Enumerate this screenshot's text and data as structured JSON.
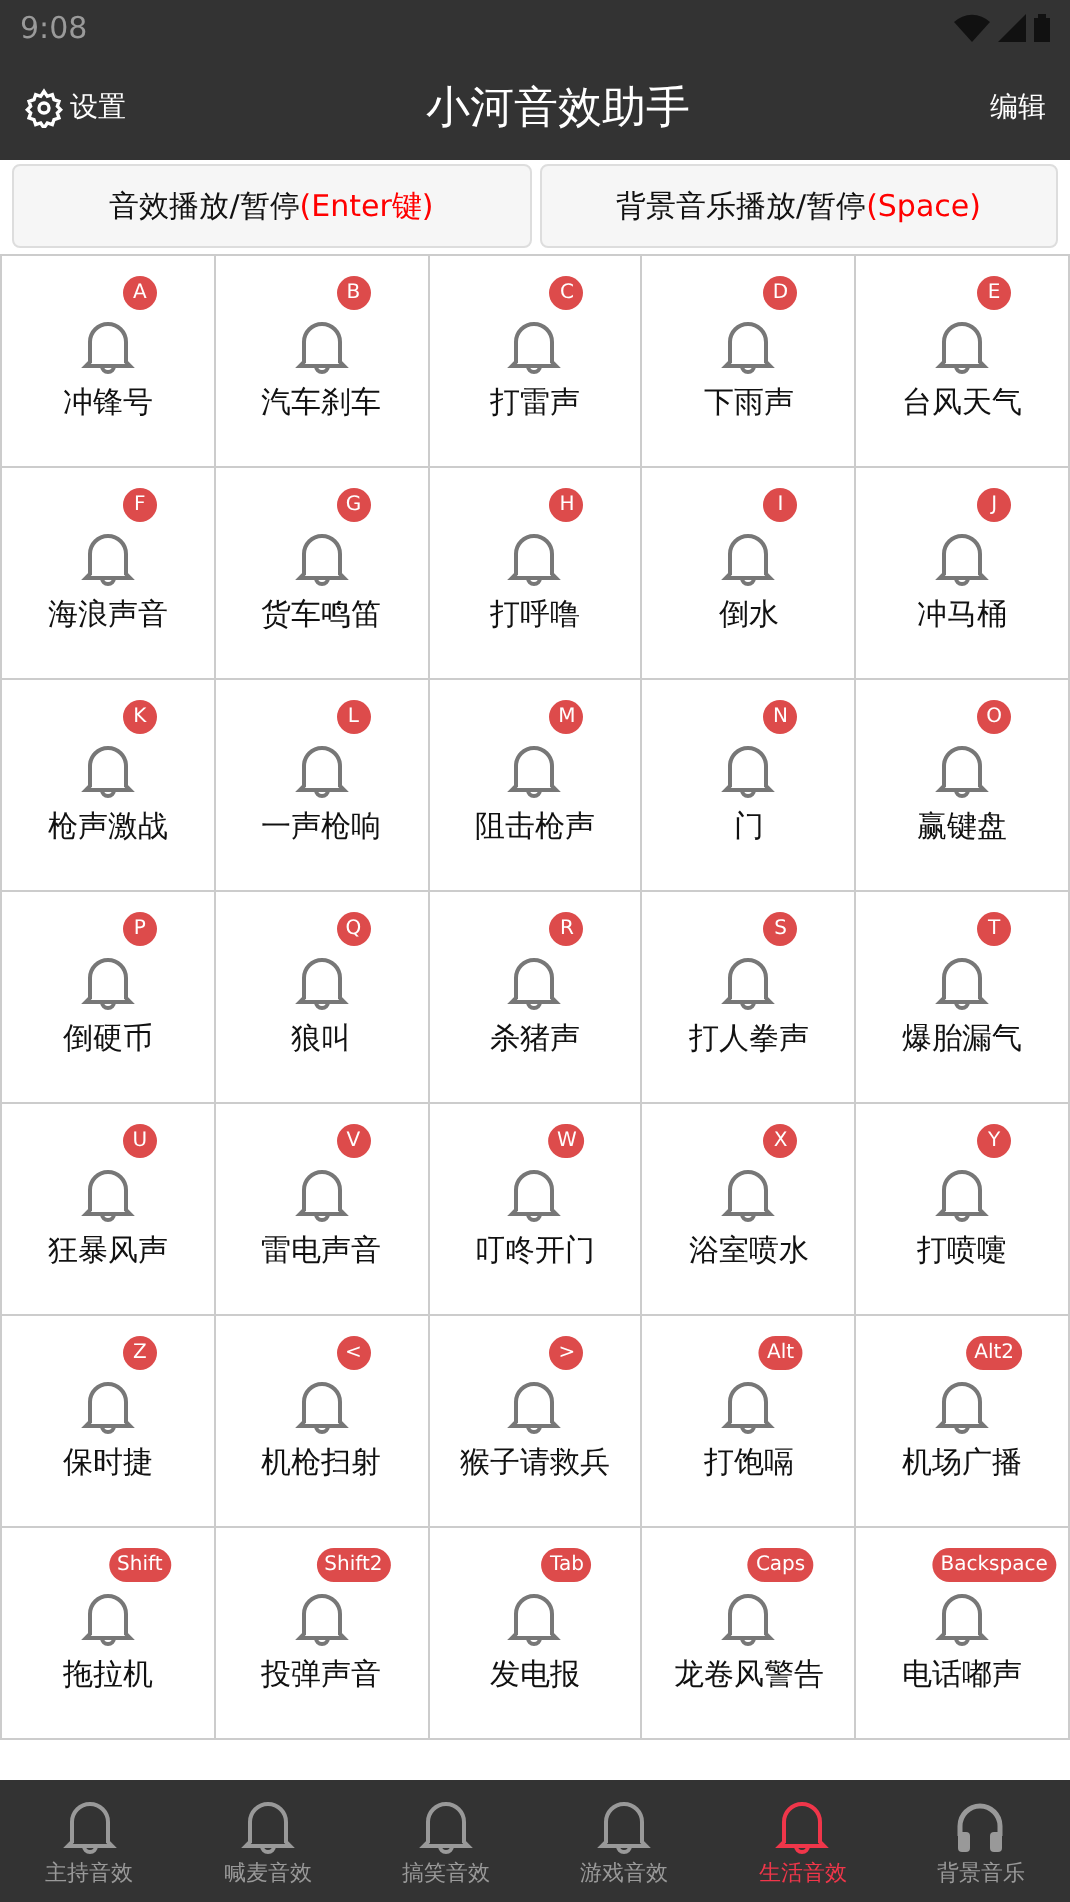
{
  "status_bar": {
    "time": "9:08"
  },
  "app_bar": {
    "settings": "设置",
    "title": "小河音效助手",
    "edit": "编辑"
  },
  "buttons": [
    {
      "label": "音效播放/暂停",
      "key": "(Enter键)"
    },
    {
      "label": "背景音乐播放/暂停",
      "key": "(Space)"
    }
  ],
  "sounds": [
    {
      "name": "冲锋号",
      "key": "A"
    },
    {
      "name": "汽车刹车",
      "key": "B"
    },
    {
      "name": "打雷声",
      "key": "C"
    },
    {
      "name": "下雨声",
      "key": "D"
    },
    {
      "name": "台风天气",
      "key": "E"
    },
    {
      "name": "海浪声音",
      "key": "F"
    },
    {
      "name": "货车鸣笛",
      "key": "G"
    },
    {
      "name": "打呼噜",
      "key": "H"
    },
    {
      "name": "倒水",
      "key": "I"
    },
    {
      "name": "冲马桶",
      "key": "J"
    },
    {
      "name": "枪声激战",
      "key": "K"
    },
    {
      "name": "一声枪响",
      "key": "L"
    },
    {
      "name": "阻击枪声",
      "key": "M"
    },
    {
      "name": "门",
      "key": "N"
    },
    {
      "name": "赢键盘",
      "key": "O"
    },
    {
      "name": "倒硬币",
      "key": "P"
    },
    {
      "name": "狼叫",
      "key": "Q"
    },
    {
      "name": "杀猪声",
      "key": "R"
    },
    {
      "name": "打人拳声",
      "key": "S"
    },
    {
      "name": "爆胎漏气",
      "key": "T"
    },
    {
      "name": "狂暴风声",
      "key": "U"
    },
    {
      "name": "雷电声音",
      "key": "V"
    },
    {
      "name": "叮咚开门",
      "key": "W"
    },
    {
      "name": "浴室喷水",
      "key": "X"
    },
    {
      "name": "打喷嚏",
      "key": "Y"
    },
    {
      "name": "保时捷",
      "key": "Z"
    },
    {
      "name": "机枪扫射",
      "key": "<"
    },
    {
      "name": "猴子请救兵",
      "key": ">"
    },
    {
      "name": "打饱嗝",
      "key": "Alt"
    },
    {
      "name": "机场广播",
      "key": "Alt2"
    },
    {
      "name": "拖拉机",
      "key": "Shift"
    },
    {
      "name": "投弹声音",
      "key": "Shift2"
    },
    {
      "name": "发电报",
      "key": "Tab"
    },
    {
      "name": "龙卷风警告",
      "key": "Caps"
    },
    {
      "name": "电话嘟声",
      "key": "Backspace"
    }
  ],
  "tabs": [
    {
      "label": "主持音效",
      "kind": "bell",
      "selected": false
    },
    {
      "label": "喊麦音效",
      "kind": "bell",
      "selected": false
    },
    {
      "label": "搞笑音效",
      "kind": "bell",
      "selected": false
    },
    {
      "label": "游戏音效",
      "kind": "bell",
      "selected": false
    },
    {
      "label": "生活音效",
      "kind": "bell",
      "selected": true
    },
    {
      "label": "背景音乐",
      "kind": "headphones",
      "selected": false
    }
  ]
}
